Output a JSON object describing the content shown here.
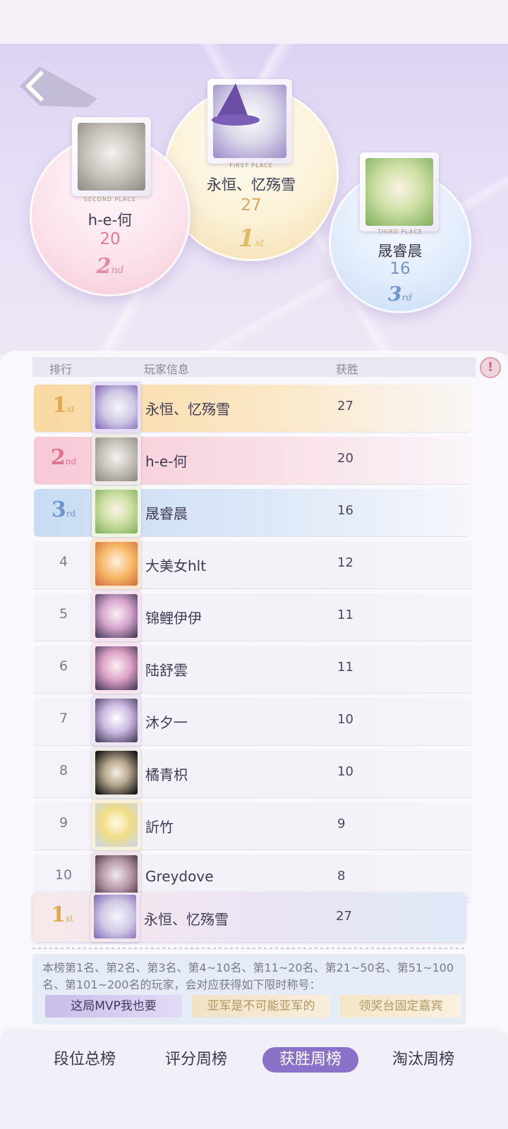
{
  "podium": {
    "first": {
      "name": "永恒、忆殇雪",
      "wins": "27",
      "place_tag": "FIRST PLACE",
      "mark": "1",
      "mark_suffix": "st"
    },
    "second": {
      "name": "h-e-何",
      "wins": "20",
      "place_tag": "SECOND PLACE",
      "mark": "2",
      "mark_suffix": "nd"
    },
    "third": {
      "name": "晟睿晨",
      "wins": "16",
      "place_tag": "THIRD PLACE",
      "mark": "3",
      "mark_suffix": "rd"
    }
  },
  "table": {
    "headers": {
      "rank": "排行",
      "player": "玩家信息",
      "wins": "获胜"
    },
    "rows": [
      {
        "rank": "1",
        "suffix": "st",
        "name": "永恒、忆殇雪",
        "wins": "27"
      },
      {
        "rank": "2",
        "suffix": "nd",
        "name": "h-e-何",
        "wins": "20"
      },
      {
        "rank": "3",
        "suffix": "rd",
        "name": "晟睿晨",
        "wins": "16"
      },
      {
        "rank": "4",
        "name": "大美女hlt",
        "wins": "12"
      },
      {
        "rank": "5",
        "name": "锦鲤伊伊",
        "wins": "11"
      },
      {
        "rank": "6",
        "name": "陆舒雲",
        "wins": "11"
      },
      {
        "rank": "7",
        "name": "沐夕一",
        "wins": "10"
      },
      {
        "rank": "8",
        "name": "橘青枳",
        "wins": "10"
      },
      {
        "rank": "9",
        "name": "訢竹",
        "wins": "9"
      },
      {
        "rank": "10",
        "name": "Greydove",
        "wins": "8"
      }
    ],
    "self": {
      "rank": "1",
      "suffix": "st",
      "name": "永恒、忆殇雪",
      "wins": "27"
    }
  },
  "notice": {
    "text": "本榜第1名、第2名、第3名、第4~10名、第11~20名、第21~50名、第51~100名、第101~200名的玩家，会对应获得如下限时称号：",
    "titles": [
      "这局MVP我也要",
      "亚军是不可能亚军的",
      "领奖台固定嘉宾"
    ]
  },
  "tabs": [
    "段位总榜",
    "评分周榜",
    "获胜周榜",
    "淘汰周榜"
  ],
  "active_tab": "获胜周榜",
  "colors": {
    "accent": "#8a72c8",
    "gold": "#e8b25a",
    "pink": "#e0738f",
    "blue": "#6f95cf"
  }
}
